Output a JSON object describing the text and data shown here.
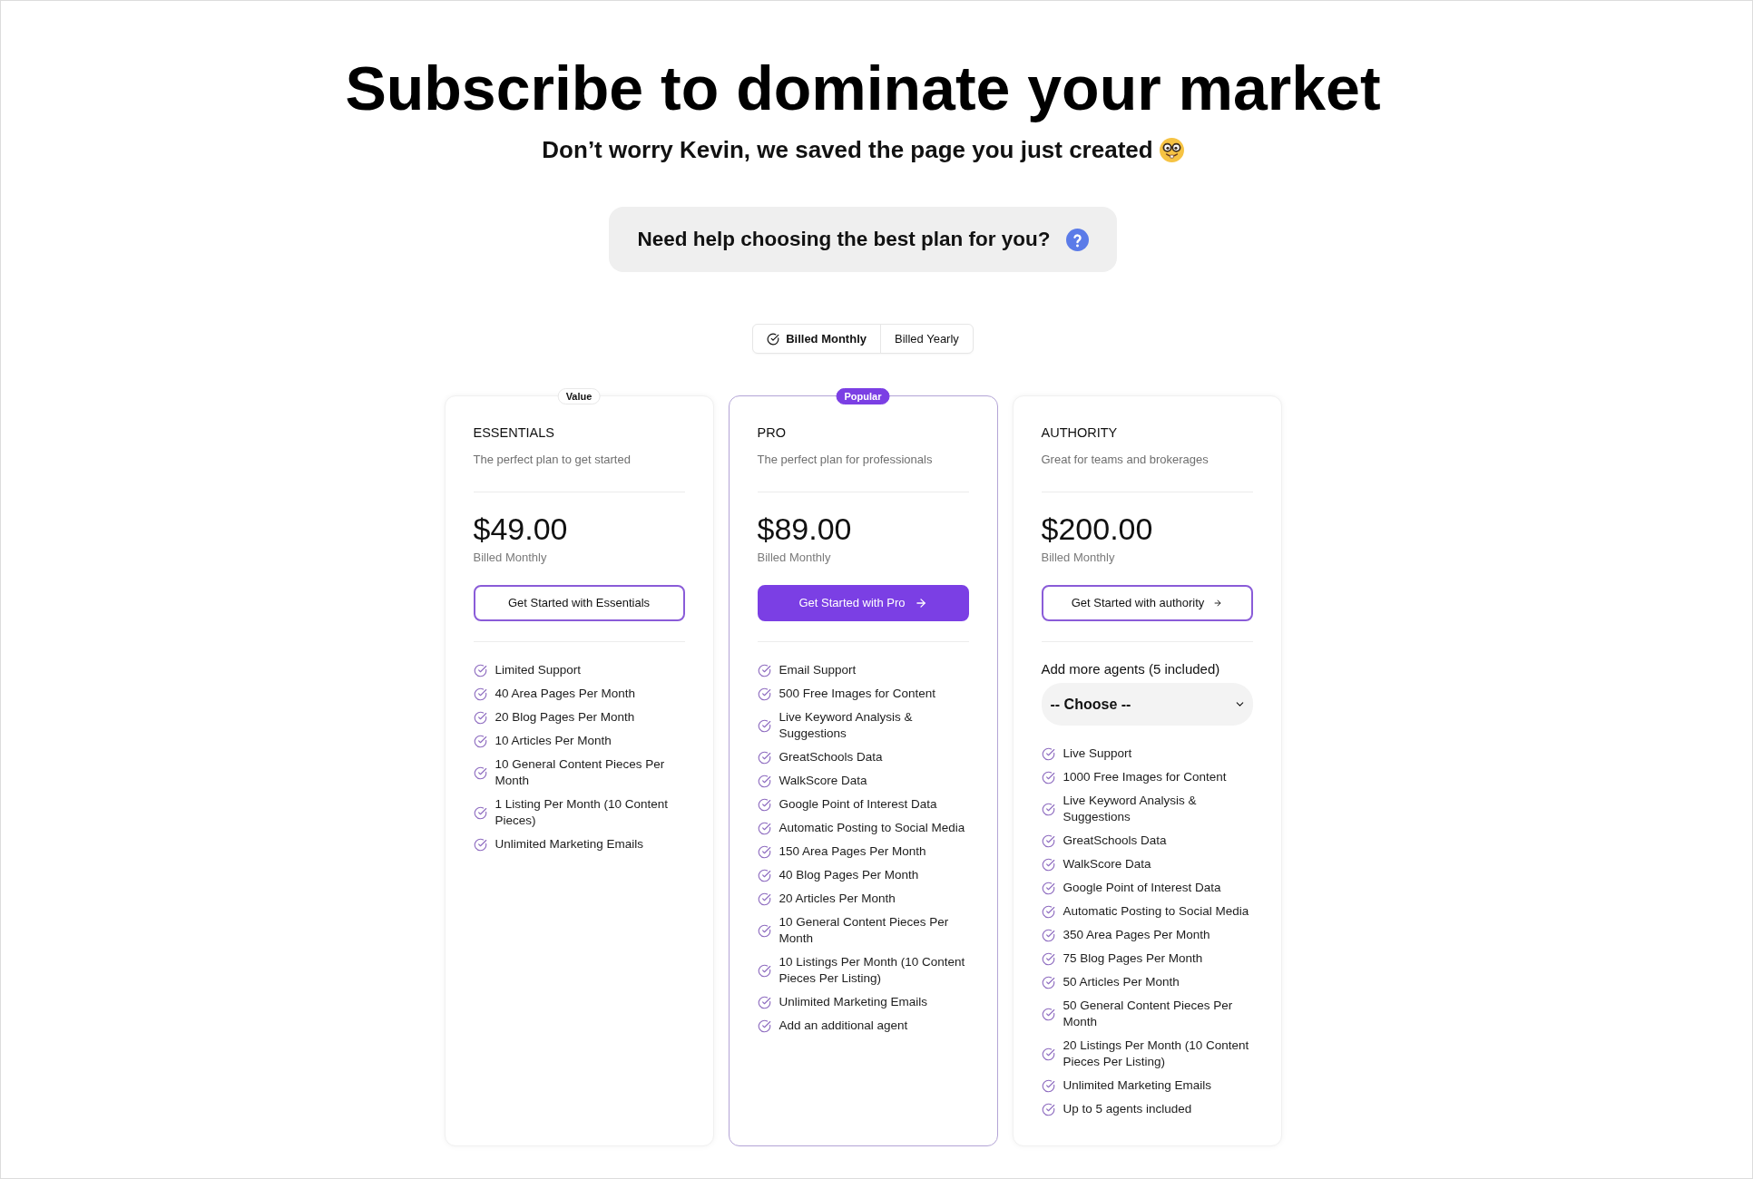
{
  "header": {
    "title": "Subscribe to dominate your market",
    "subtitle": "Don’t worry Kevin, we saved the page you just created"
  },
  "help_banner": {
    "text": "Need help choosing the best plan for you?"
  },
  "billing_toggle": [
    {
      "label": "Billed Monthly",
      "selected": true
    },
    {
      "label": "Billed Yearly",
      "selected": false
    }
  ],
  "plans": [
    {
      "badge": {
        "label": "Value",
        "kind": "plain"
      },
      "highlighted": false,
      "name": "ESSENTIALS",
      "description": "The perfect plan to get started",
      "price": "$49.00",
      "billing": "Billed Monthly",
      "button": {
        "label": "Get Started with Essentials",
        "kind": "outline",
        "arrow": false
      },
      "features": [
        "Limited Support",
        "40 Area Pages Per Month",
        "20 Blog Pages Per Month",
        "10 Articles Per Month",
        "10 General Content Pieces Per Month",
        "1 Listing Per Month (10 Content Pieces)",
        "Unlimited Marketing Emails"
      ]
    },
    {
      "badge": {
        "label": "Popular",
        "kind": "accent"
      },
      "highlighted": true,
      "name": "PRO",
      "description": "The perfect plan for professionals",
      "price": "$89.00",
      "billing": "Billed Monthly",
      "button": {
        "label": "Get Started with Pro",
        "kind": "filled",
        "arrow": true
      },
      "features": [
        "Email Support",
        "500 Free Images for Content",
        "Live Keyword Analysis & Suggestions",
        "GreatSchools Data",
        "WalkScore Data",
        "Google Point of Interest Data",
        "Automatic Posting to Social Media",
        "150 Area Pages Per Month",
        "40 Blog Pages Per Month",
        "20 Articles Per Month",
        "10 General Content Pieces Per Month",
        "10 Listings Per Month (10 Content Pieces Per Listing)",
        "Unlimited Marketing Emails",
        "Add an additional agent"
      ]
    },
    {
      "highlighted": false,
      "name": "AUTHORITY",
      "description": "Great for teams and brokerages",
      "price": "$200.00",
      "billing": "Billed Monthly",
      "button": {
        "label": "Get Started with authority",
        "kind": "outline",
        "arrow": true
      },
      "agents": {
        "label": "Add more agents (5 included)",
        "value": "-- Choose --"
      },
      "features": [
        "Live Support",
        "1000 Free Images for Content",
        "Live Keyword Analysis & Suggestions",
        "GreatSchools Data",
        "WalkScore Data",
        "Google Point of Interest Data",
        "Automatic Posting to Social Media",
        "350 Area Pages Per Month",
        "75 Blog Pages Per Month",
        "50 Articles Per Month",
        "50 General Content Pieces Per Month",
        "20 Listings Per Month (10 Content Pieces Per Listing)",
        "Unlimited Marketing Emails",
        "Up to 5 agents included"
      ]
    }
  ]
}
